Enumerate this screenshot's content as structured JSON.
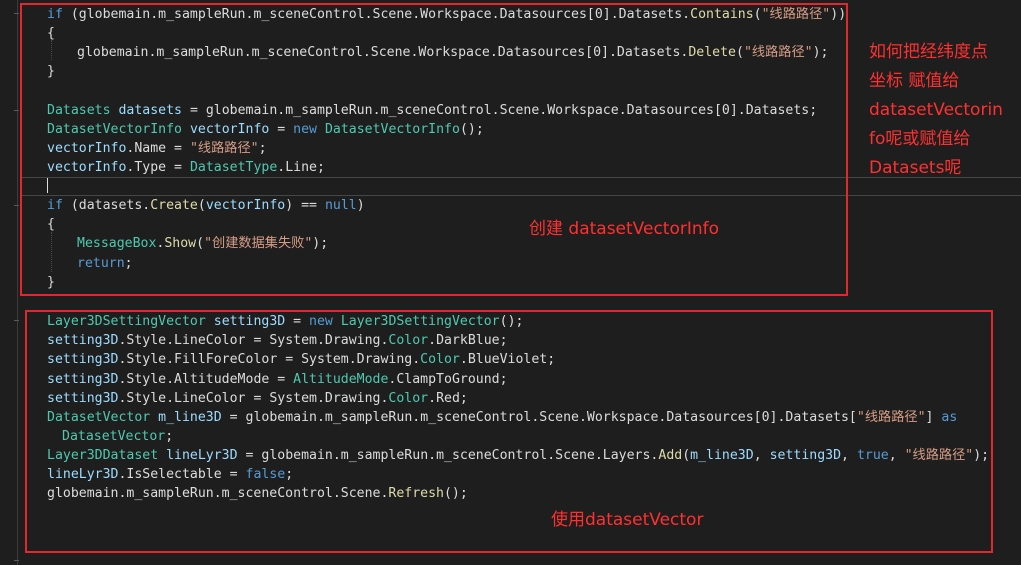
{
  "editor": {
    "block1": {
      "line1": {
        "kw_if": "if",
        "p1": " (globemain.m_sampleRun.m_sceneControl.Scene.Workspace.Datasources[0].Datasets.",
        "m_contains": "Contains",
        "p2": "(",
        "s": "\"线路路径\"",
        "p3": "))"
      },
      "line2": {
        "brace": "{"
      },
      "line3": {
        "p1": "globemain.m_sampleRun.m_sceneControl.Scene.Workspace.Datasources[0].Datasets.",
        "m_delete": "Delete",
        "p2": "(",
        "s": "\"线路路径\"",
        "p3": ");"
      },
      "line4": {
        "brace": "}"
      },
      "line5": {
        "t1": "Datasets",
        "v1": "datasets",
        "p1": " = globemain.m_sampleRun.m_sceneControl.Scene.Workspace.Datasources[0].Datasets;"
      },
      "line6": {
        "t1": "DatasetVectorInfo",
        "v1": "vectorInfo",
        "p1": " = ",
        "kw_new": "new",
        "t2": "DatasetVectorInfo",
        "p2": "();"
      },
      "line7": {
        "v1": "vectorInfo",
        "p1": ".Name = ",
        "s": "\"线路路径\"",
        "p2": ";"
      },
      "line8": {
        "v1": "vectorInfo",
        "p1": ".Type = ",
        "t1": "DatasetType",
        "p2": ".Line;"
      },
      "line9": {
        "kw_if": "if",
        "p1": " (datasets.",
        "m_create": "Create",
        "p2": "(",
        "v1": "vectorInfo",
        "p3": ") == ",
        "kw_null": "null",
        "p4": ")"
      },
      "line10": {
        "brace": "{"
      },
      "line11": {
        "t1": "MessageBox",
        "p1": ".",
        "m_show": "Show",
        "p2": "(",
        "s": "\"创建数据集失败\"",
        "p3": ");"
      },
      "line12": {
        "kw_return": "return",
        "p1": ";"
      },
      "line13": {
        "brace": "}"
      }
    },
    "block2": {
      "line1": {
        "t1": "Layer3DSettingVector",
        "v1": "setting3D",
        "p1": " = ",
        "kw_new": "new",
        "t2": "Layer3DSettingVector",
        "p2": "();"
      },
      "line2": {
        "v1": "setting3D",
        "p1": ".Style.LineColor = System.Drawing.",
        "t1": "Color",
        "p2": ".DarkBlue;"
      },
      "line3": {
        "v1": "setting3D",
        "p1": ".Style.FillForeColor = System.Drawing.",
        "t1": "Color",
        "p2": ".BlueViolet;"
      },
      "line4": {
        "v1": "setting3D",
        "p1": ".Style.AltitudeMode = ",
        "t1": "AltitudeMode",
        "p2": ".ClampToGround;"
      },
      "line5": {
        "v1": "setting3D",
        "p1": ".Style.LineColor = System.Drawing.",
        "t1": "Color",
        "p2": ".Red;"
      },
      "line6": {
        "t1": "DatasetVector",
        "v1": "m_line3D",
        "p1": " = globemain.m_sampleRun.m_sceneControl.Scene.Workspace.Datasources[0].Datasets[",
        "s": "\"线路路径\"",
        "p2": "] ",
        "kw_as": "as"
      },
      "line7": {
        "t1": "DatasetVector",
        "p1": ";"
      },
      "line8": {
        "t1": "Layer3DDataset",
        "v1": "lineLyr3D",
        "p1": " = globemain.m_sampleRun.m_sceneControl.Scene.Layers.",
        "m_add": "Add",
        "p2": "(",
        "v2": "m_line3D",
        "p3": ", ",
        "v3": "setting3D",
        "p4": ", ",
        "kw_true": "true",
        "p5": ", ",
        "s": "\"线路路径\"",
        "p6": ");"
      },
      "line9": {
        "v1": "lineLyr3D",
        "p1": ".IsSelectable = ",
        "kw_false": "false",
        "p2": ";"
      },
      "line10": {
        "p1": "globemain.m_sampleRun.m_sceneControl.Scene.",
        "m_refresh": "Refresh",
        "p2": "();"
      }
    }
  },
  "annotations": {
    "note_right": [
      "如何把经纬度点",
      "坐标 赋值给",
      "datasetVectorin",
      "fo呢或赋值给",
      "Datasets呢"
    ],
    "note_create": "创建 datasetVectorInfo",
    "note_use": "使用datasetVector"
  },
  "colors": {
    "background": "#1e1e1e",
    "keyword": "#569cd6",
    "type": "#4ec9b0",
    "string": "#d69d85",
    "variable": "#9cdcfe",
    "method": "#dcdcaa",
    "text": "#dcdcdc",
    "annotation": "#e0282e"
  }
}
